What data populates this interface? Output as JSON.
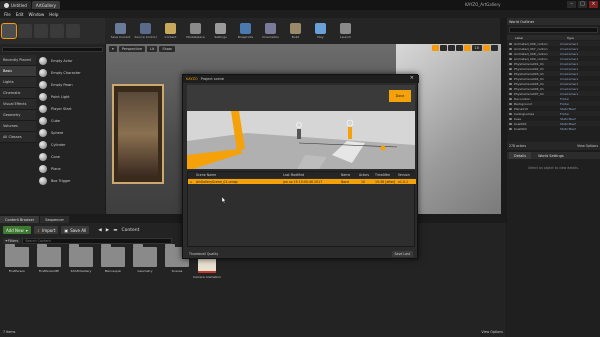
{
  "window": {
    "tabs": [
      {
        "label": "Untitled"
      },
      {
        "label": "ArtGallery"
      }
    ],
    "app_label": "KAYZO_ArtGallery",
    "controls": {
      "minimize": "–",
      "maximize": "□",
      "close": "×"
    }
  },
  "menubar": [
    "File",
    "Edit",
    "Window",
    "Help"
  ],
  "toolbar": [
    {
      "label": "Save Current",
      "color": "#6a7a9a"
    },
    {
      "label": "Source Control",
      "color": "#5a6a8a"
    },
    {
      "label": "Content",
      "color": "#c8a85a"
    },
    {
      "label": "Marketplace",
      "color": "#8a8a8a"
    },
    {
      "label": "Settings",
      "color": "#9a9a9a"
    },
    {
      "label": "Blueprints",
      "color": "#4a7ab0"
    },
    {
      "label": "Cinematics",
      "color": "#7a7a9a"
    },
    {
      "label": "Build",
      "color": "#9a8a6a"
    },
    {
      "label": "Play",
      "color": "#6aa0d8"
    },
    {
      "label": "Launch",
      "color": "#8a8a8a"
    }
  ],
  "place": {
    "categories": [
      "Recently Placed",
      "Basic",
      "Lights",
      "Cinematic",
      "Visual Effects",
      "Geometry",
      "Volumes",
      "All Classes"
    ],
    "selected_category": "Basic",
    "items": [
      "Empty Actor",
      "Empty Character",
      "Empty Pawn",
      "Point Light",
      "Player Start",
      "Cube",
      "Sphere",
      "Cylinder",
      "Cone",
      "Plane",
      "Box Trigger"
    ]
  },
  "viewport": {
    "buttons": [
      "Perspective",
      "Lit",
      "Show"
    ],
    "right_value": "10"
  },
  "outliner": {
    "title": "World Outliner",
    "columns": {
      "label": "Label",
      "type": "Type"
    },
    "rows": [
      {
        "label": "Animated_006_carbon",
        "type": "CineCamera"
      },
      {
        "label": "Animated_007_carbon",
        "type": "CineCamera"
      },
      {
        "label": "Animated_008_carbon",
        "type": "CineCamera"
      },
      {
        "label": "Animated_009_carbon",
        "type": "CineCamera"
      },
      {
        "label": "PhysCamera001_01",
        "type": "CineCamera"
      },
      {
        "label": "PhysCamera002_01",
        "type": "CineCamera"
      },
      {
        "label": "PhysCamera003_01",
        "type": "CineCamera"
      },
      {
        "label": "PhysCamera004_01",
        "type": "CineCamera"
      },
      {
        "label": "PhysCamera005_01",
        "type": "CineCamera"
      },
      {
        "label": "PhysCamera006_01",
        "type": "CineCamera"
      },
      {
        "label": "PhysCamera007_01",
        "type": "CineCamera"
      },
      {
        "label": "Decoration",
        "type": "Folder"
      },
      {
        "label": "Background",
        "type": "Folder"
      },
      {
        "label": "Plane010",
        "type": "StaticMesh"
      },
      {
        "label": "CeilingLamps",
        "type": "Folder"
      },
      {
        "label": "base",
        "type": "StaticMesh"
      },
      {
        "label": "bowl001",
        "type": "StaticMesh"
      },
      {
        "label": "bowl002",
        "type": "StaticMesh"
      }
    ],
    "actors_count": "278 actors",
    "view_options": "View Options"
  },
  "details": {
    "tabs": [
      "Details",
      "World Settings"
    ],
    "empty_text": "Select an object to view details."
  },
  "content_browser": {
    "tabs": [
      "Content Browser",
      "Sequencer"
    ],
    "add_new": "Add New",
    "import": "Import",
    "save_all": "Save All",
    "path": "Content",
    "filters": "Filters",
    "search_placeholder": "Search Content",
    "folders": [
      "FirstPerson",
      "FirstPersonBP",
      "KAYZOGallery",
      "Mannequin",
      "Geometry",
      "Scenes"
    ],
    "asset": "Camera Animation",
    "items_count": "7 items",
    "view_options": "View Options"
  },
  "dialog": {
    "title": "Project scene",
    "brand": "KAYZO",
    "open_button": "Done",
    "columns": [
      "Scene Name",
      "Last Modified",
      "Name",
      "Actors",
      "TimeAfter",
      "Version"
    ],
    "row": [
      "ArtGalleryScene_01.umap",
      "jan xx 19 10:05:46 2017",
      "None",
      "10",
      "15:36 [after]",
      "v1.0.1"
    ],
    "footer_left": "Thumbnail Quality",
    "footer_right": "Save Last"
  }
}
